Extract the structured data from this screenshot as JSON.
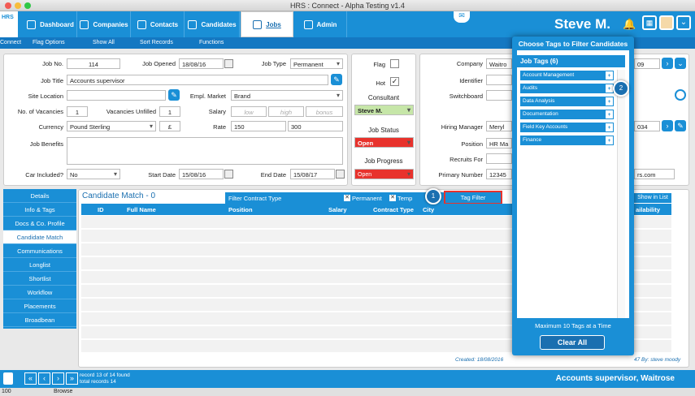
{
  "window": {
    "title": "HRS : Connect - Alpha Testing v1.4"
  },
  "nav": {
    "logo": "HRS",
    "items": [
      "Dashboard",
      "Companies",
      "Contacts",
      "Candidates",
      "Jobs",
      "Admin"
    ],
    "user": "Steve M."
  },
  "subnav": {
    "app": "Connect",
    "items": [
      "Flag Options",
      "Show All",
      "Sort Records",
      "Functions"
    ],
    "right": "Functions"
  },
  "job": {
    "job_no_label": "Job No.",
    "job_no": "114",
    "job_opened_label": "Job Opened",
    "job_opened": "18/08/16",
    "job_type_label": "Job Type",
    "job_type": "Permanent",
    "job_title_label": "Job Title",
    "job_title": "Accounts supervisor",
    "site_location_label": "Site Location",
    "site_location": "",
    "empl_market_label": "Empl. Market",
    "empl_market": "Brand",
    "vacancies_label": "No. of Vacancies",
    "vacancies": "1",
    "unfilled_label": "Vacancies Unfilled",
    "unfilled": "1",
    "salary_label": "Salary",
    "salary_low": "low",
    "salary_high": "high",
    "salary_bonus": "bonus",
    "currency_label": "Currency",
    "currency": "Pound Sterling",
    "currency_symbol": "£",
    "rate_label": "Rate",
    "rate_from": "150",
    "rate_to": "300",
    "benefits_label": "Job Benefits",
    "benefits": "",
    "car_label": "Car Included?",
    "car": "No",
    "start_label": "Start Date",
    "start": "15/08/16",
    "end_label": "End Date",
    "end": "15/08/17"
  },
  "flags": {
    "flag_label": "Flag",
    "hot_label": "Hot",
    "consultant_label": "Consultant",
    "consultant": "Steve M.",
    "status_label": "Job Status",
    "status": "Open",
    "progress_label": "Job Progress",
    "progress": "Open"
  },
  "company": {
    "company_label": "Company",
    "company": "Waitro",
    "id_label": "Identifier",
    "switchboard_label": "Switchboard",
    "hm_label": "Hiring Manager",
    "hm": "Meryl",
    "position_label": "Position",
    "position": "HR Ma",
    "recruits_label": "Recruits For",
    "primary_label": "Primary Number",
    "primary": "12345",
    "num_right1": "09",
    "num_right2": "034",
    "web_right": "rs.com"
  },
  "side": {
    "items": [
      "Details",
      "Info & Tags",
      "Docs & Co. Profile",
      "Candidate Match",
      "Communications",
      "Longlist",
      "Shortlist",
      "Workflow",
      "Placements",
      "Broadbean"
    ]
  },
  "match": {
    "title": "Candidate Match - 0",
    "filter_title": "Filter Contract Type",
    "perm_label": "Permanent",
    "temp_label": "Temp",
    "tag_filter": "Tag Filter",
    "show_in_list": "Show in List",
    "columns": [
      "ID",
      "Full Name",
      "Position",
      "Salary",
      "Contract Type",
      "City",
      "ailability"
    ],
    "created": "Created: 18/08/2016",
    "modified": "47 By: steve moody"
  },
  "status": {
    "record": "record 13 of 14 found",
    "total": "total records 14",
    "title": "Accounts supervisor, Waitrose"
  },
  "footer": {
    "zoom": "100",
    "mode": "Browse"
  },
  "tags": {
    "title": "Choose Tags to Filter Candidates",
    "group": "Job Tags (6)",
    "items": [
      "Account Management",
      "Audits",
      "Data Analysis",
      "Documentation",
      "Field Key Accounts",
      "Finance"
    ],
    "max": "Maximum 10 Tags at a Time",
    "clear": "Clear All"
  },
  "callouts": {
    "one": "1",
    "two": "2"
  },
  "colors": {
    "accent": "#1a8fd6",
    "red": "#e8322c",
    "green": "#c6e6a8"
  }
}
